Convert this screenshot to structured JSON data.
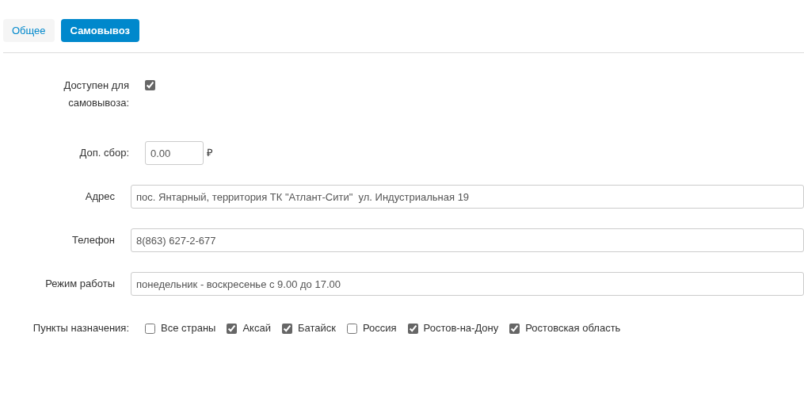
{
  "tabs": [
    {
      "label": "Общее",
      "selected": false
    },
    {
      "label": "Самовывоз",
      "selected": true
    }
  ],
  "pickup": {
    "label": "Доступен для самовывоза:",
    "checked": true
  },
  "fee": {
    "label": "Доп. сбор:",
    "value": "0.00",
    "currency": "₽"
  },
  "fields": [
    {
      "label": "Адрес",
      "value": "пос. Янтарный, территория ТК \"Атлант-Сити\"  ул. Индустриальная 19"
    },
    {
      "label": "Телефон",
      "value": "8(863) 627-2-677"
    },
    {
      "label": "Режим работы",
      "value": "понедельник - воскресенье с 9.00 до 17.00"
    }
  ],
  "destinations": {
    "label": "Пункты назначения:",
    "items": [
      {
        "label": "Все страны",
        "checked": false
      },
      {
        "label": "Аксай",
        "checked": true
      },
      {
        "label": "Батайск",
        "checked": true
      },
      {
        "label": "Россия",
        "checked": false
      },
      {
        "label": "Ростов-на-Дону",
        "checked": true
      },
      {
        "label": "Ростовская область",
        "checked": true
      }
    ]
  }
}
